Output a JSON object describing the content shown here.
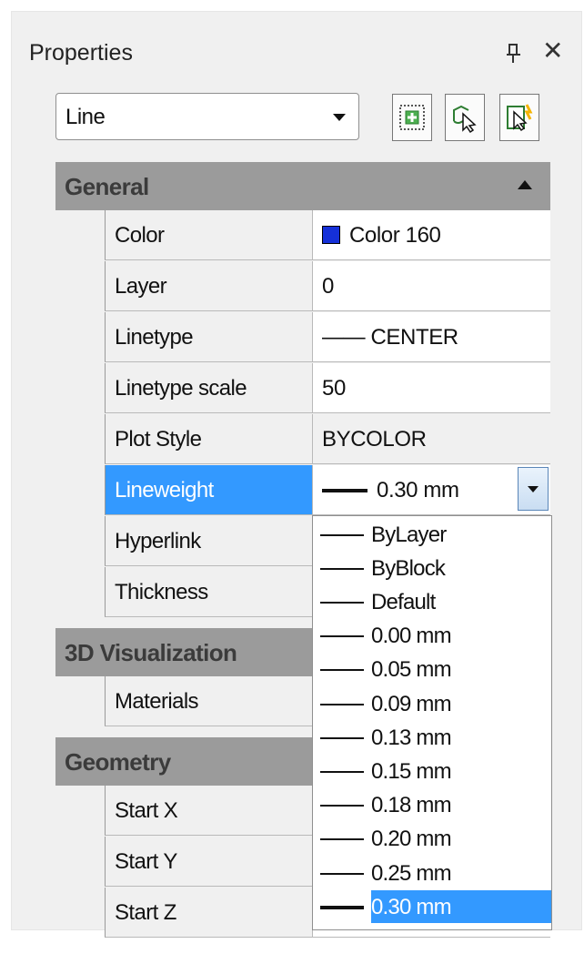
{
  "panel": {
    "title": "Properties"
  },
  "object_select": {
    "value": "Line"
  },
  "toolbar": {
    "buttons": [
      {
        "name": "toggle-pickadd-button",
        "icon": "pickadd-icon"
      },
      {
        "name": "select-objects-button",
        "icon": "select-objects-icon"
      },
      {
        "name": "quick-select-button",
        "icon": "quick-select-icon"
      }
    ]
  },
  "sections": {
    "general": "General",
    "visualization": "3D Visualization",
    "geometry": "Geometry"
  },
  "general_rows": [
    {
      "key": "Color",
      "value": "Color 160",
      "swatch": "#1530d8"
    },
    {
      "key": "Layer",
      "value": "0"
    },
    {
      "key": "Linetype",
      "value": "—— CENTER"
    },
    {
      "key": "Linetype scale",
      "value": "50"
    },
    {
      "key": "Plot Style",
      "value": "BYCOLOR"
    },
    {
      "key": "Lineweight",
      "value": "0.30 mm"
    },
    {
      "key": "Hyperlink",
      "value": ""
    },
    {
      "key": "Thickness",
      "value": ""
    }
  ],
  "visualization_rows": [
    {
      "key": "Materials",
      "value": ""
    }
  ],
  "geometry_rows": [
    {
      "key": "Start X",
      "value": ""
    },
    {
      "key": "Start Y",
      "value": ""
    },
    {
      "key": "Start Z",
      "value": ""
    }
  ],
  "lineweight_options": [
    "ByLayer",
    "ByBlock",
    "Default",
    "0.00 mm",
    "0.05 mm",
    "0.09 mm",
    "0.13 mm",
    "0.15 mm",
    "0.18 mm",
    "0.20 mm",
    "0.25 mm",
    "0.30 mm"
  ],
  "lineweight_selected": "0.30 mm",
  "colors": {
    "selection": "#3399ff",
    "section_header": "#9b9b9b"
  }
}
